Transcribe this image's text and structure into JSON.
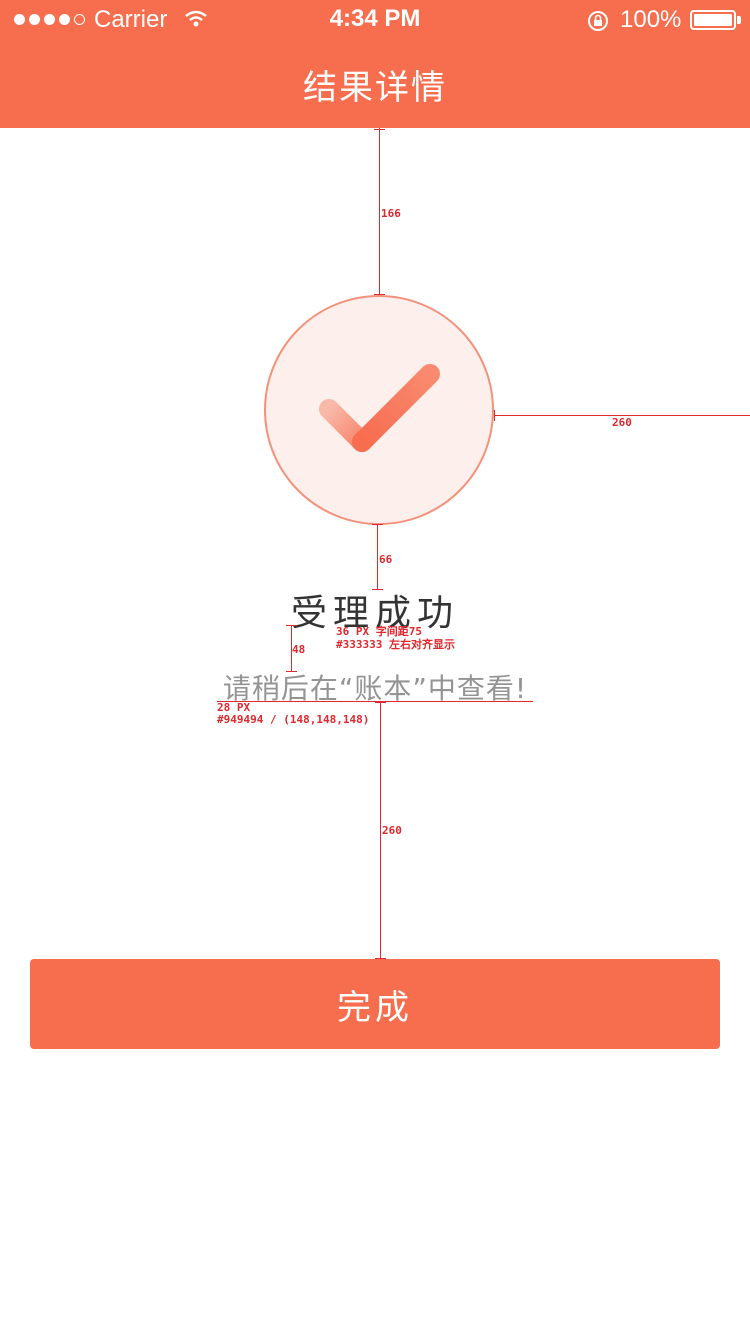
{
  "status_bar": {
    "carrier": "Carrier",
    "time": "4:34 PM",
    "battery": "100%",
    "signal_strength": "4 of 5 bars",
    "icons": [
      "wifi-icon",
      "rotation-lock-icon",
      "battery-icon"
    ]
  },
  "nav": {
    "title": "结果详情"
  },
  "result": {
    "title": "受理成功",
    "subtitle": "请稍后在“账本”中查看!",
    "icon": "checkmark-icon"
  },
  "annotations": {
    "top_gap": "166",
    "right_gap": "260",
    "icon_gap": "66",
    "text_gap": "48",
    "bottom_gap": "260",
    "title_spec_1": "36 PX  字间距75",
    "title_spec_2": "#333333  左右对齐显示",
    "subtitle_spec_1": "28 PX",
    "subtitle_spec_2": "#949494 / (148,148,148)"
  },
  "button": {
    "label": "完成"
  },
  "colors": {
    "accent": "#f76e4f",
    "circle_bg": "#fdefec",
    "circle_border": "#f4917b",
    "title_text": "#333333",
    "subtitle_text": "#949494",
    "annotation": "#e0282d"
  }
}
